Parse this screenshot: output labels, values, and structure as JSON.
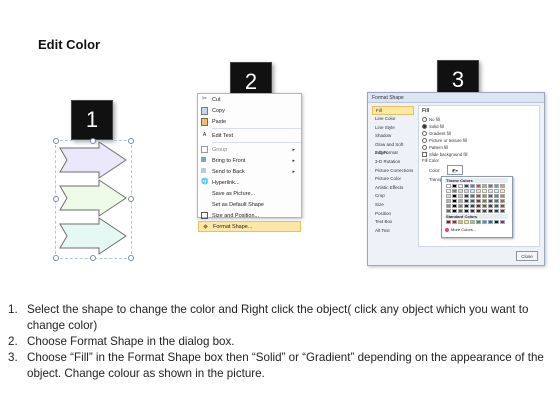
{
  "title": "Edit Color",
  "badges": [
    "1",
    "2",
    "3"
  ],
  "context_menu": {
    "items": [
      {
        "label": "Cut",
        "icon": "scissors-icon"
      },
      {
        "label": "Copy",
        "icon": "copy-icon"
      },
      {
        "label": "Paste",
        "icon": "paste-icon"
      },
      {
        "label": "Edit Text",
        "icon": "edit-text-icon"
      },
      {
        "label": "Group",
        "icon": "group-icon",
        "submenu": true
      },
      {
        "label": "Bring to Front",
        "icon": "bring-front-icon",
        "submenu": true
      },
      {
        "label": "Send to Back",
        "icon": "send-back-icon",
        "submenu": true
      },
      {
        "label": "Hyperlink...",
        "icon": "hyperlink-icon"
      },
      {
        "label": "Save as Picture...",
        "icon": ""
      },
      {
        "label": "Set as Default Shape",
        "icon": ""
      },
      {
        "label": "Size and Position...",
        "icon": "size-icon"
      },
      {
        "label": "Format Shape...",
        "icon": "format-shape-icon",
        "highlighted": true
      }
    ]
  },
  "format_dialog": {
    "title": "Format Shape",
    "categories": [
      "Fill",
      "Line Color",
      "Line Style",
      "Shadow",
      "Glow and Soft Edges",
      "3-D Format",
      "3-D Rotation",
      "Picture Corrections",
      "Picture Color",
      "Artistic Effects",
      "Crop",
      "Size",
      "Position",
      "Text Box",
      "Alt Text"
    ],
    "section_title": "Fill",
    "fill_options": [
      "No fill",
      "Solid fill",
      "Gradient fill",
      "Picture or texture fill",
      "Pattern fill",
      "Slide background fill"
    ],
    "fill_color_label": "Fill Color",
    "color_label": "Color:",
    "transparency_label": "Transparency:",
    "close_label": "Close",
    "palette": {
      "theme_label": "Theme Colors",
      "standard_label": "Standard Colors",
      "more_label": "More Colors...",
      "theme_top": [
        "#ffffff",
        "#000000",
        "#eeece1",
        "#1f497d",
        "#4f81bd",
        "#c0504d",
        "#9bbb59",
        "#8064a2",
        "#4bacc6",
        "#f79646"
      ],
      "theme_shades": [
        "#f2f2f2",
        "#7f7f7f",
        "#ddd9c3",
        "#c6d9f0",
        "#dbe5f1",
        "#f2dcdb",
        "#ebf1dd",
        "#e5e0ec",
        "#dbeef3",
        "#fdeada"
      ],
      "standard": [
        "#c00000",
        "#ff0000",
        "#ffc000",
        "#ffff00",
        "#92d050",
        "#00b050",
        "#00b0f0",
        "#0070c0",
        "#002060",
        "#7030a0"
      ]
    }
  },
  "shapes": [
    {
      "color": "#ece8fb",
      "stroke": "#6e6e6e"
    },
    {
      "color": "#eefbe6",
      "stroke": "#6e6e6e"
    },
    {
      "color": "#e6f8f3",
      "stroke": "#6e6e6e"
    }
  ],
  "steps": [
    {
      "num": "1.",
      "text": "Select the shape to change the color and Right click the object( click any object which you want to change color)"
    },
    {
      "num": "2.",
      "text": "Choose Format Shape in the dialog box."
    },
    {
      "num": "3.",
      "text": "Choose “Fill” in the Format Shape box then “Solid” or “Gradient” depending on the appearance of the object. Change colour as shown in the picture."
    }
  ]
}
